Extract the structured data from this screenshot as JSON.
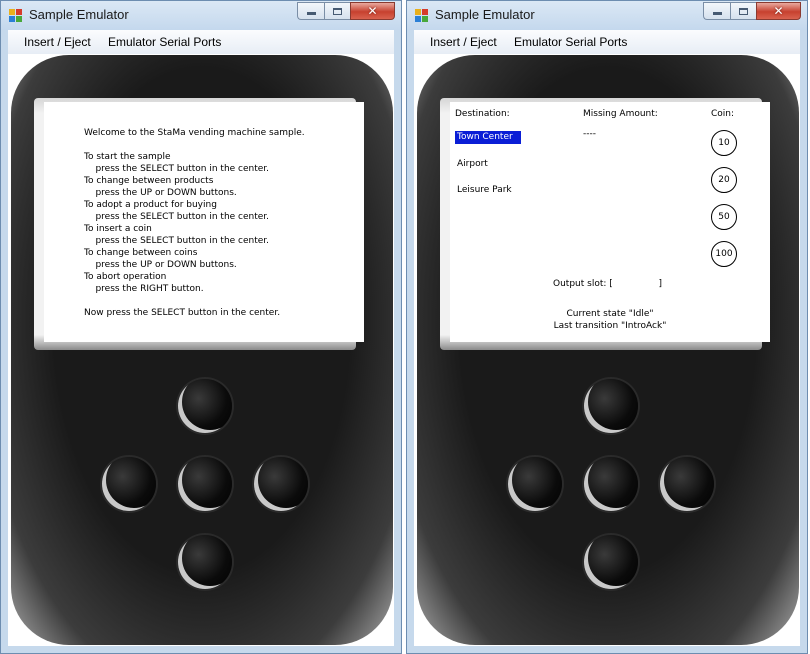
{
  "left_window": {
    "title": "Sample Emulator",
    "icon": "app-icon",
    "caption": {
      "minimize": "minimize-icon",
      "maximize": "maximize-icon",
      "close": "✕"
    },
    "menu": [
      "Insert / Eject",
      "Emulator Serial Ports"
    ],
    "screen_lines": [
      "Welcome to the StaMa vending machine sample.",
      "",
      "To start the sample",
      "    press the SELECT button in the center.",
      "To change between products",
      "    press the UP or DOWN buttons.",
      "To adopt a product for buying",
      "    press the SELECT button in the center.",
      "To insert a coin",
      "    press the SELECT button in the center.",
      "To change between coins",
      "    press the UP or DOWN buttons.",
      "To abort operation",
      "    press the RIGHT button.",
      "",
      "Now press the SELECT button in the center."
    ]
  },
  "right_window": {
    "title": "Sample Emulator",
    "icon": "app-icon",
    "caption": {
      "minimize": "minimize-icon",
      "maximize": "maximize-icon",
      "close": "✕"
    },
    "menu": [
      "Insert / Eject",
      "Emulator Serial Ports"
    ],
    "screen": {
      "destination_header": "Destination:",
      "missing_header": "Missing Amount:",
      "coin_header": "Coin:",
      "destinations": [
        "Town Center",
        "Airport",
        "Leisure Park"
      ],
      "selected_destination": "Town Center",
      "missing_amount": "----",
      "coins": [
        "10",
        "20",
        "50",
        "100"
      ],
      "output_slot": "Output slot: [                ]",
      "current_state": "Current state \"Idle\"",
      "last_transition": "Last transition \"IntroAck\""
    }
  },
  "colors": {
    "selection": "#0a1ed6",
    "window_frame": "#c6d9ec",
    "close_button": "#c7412f"
  }
}
